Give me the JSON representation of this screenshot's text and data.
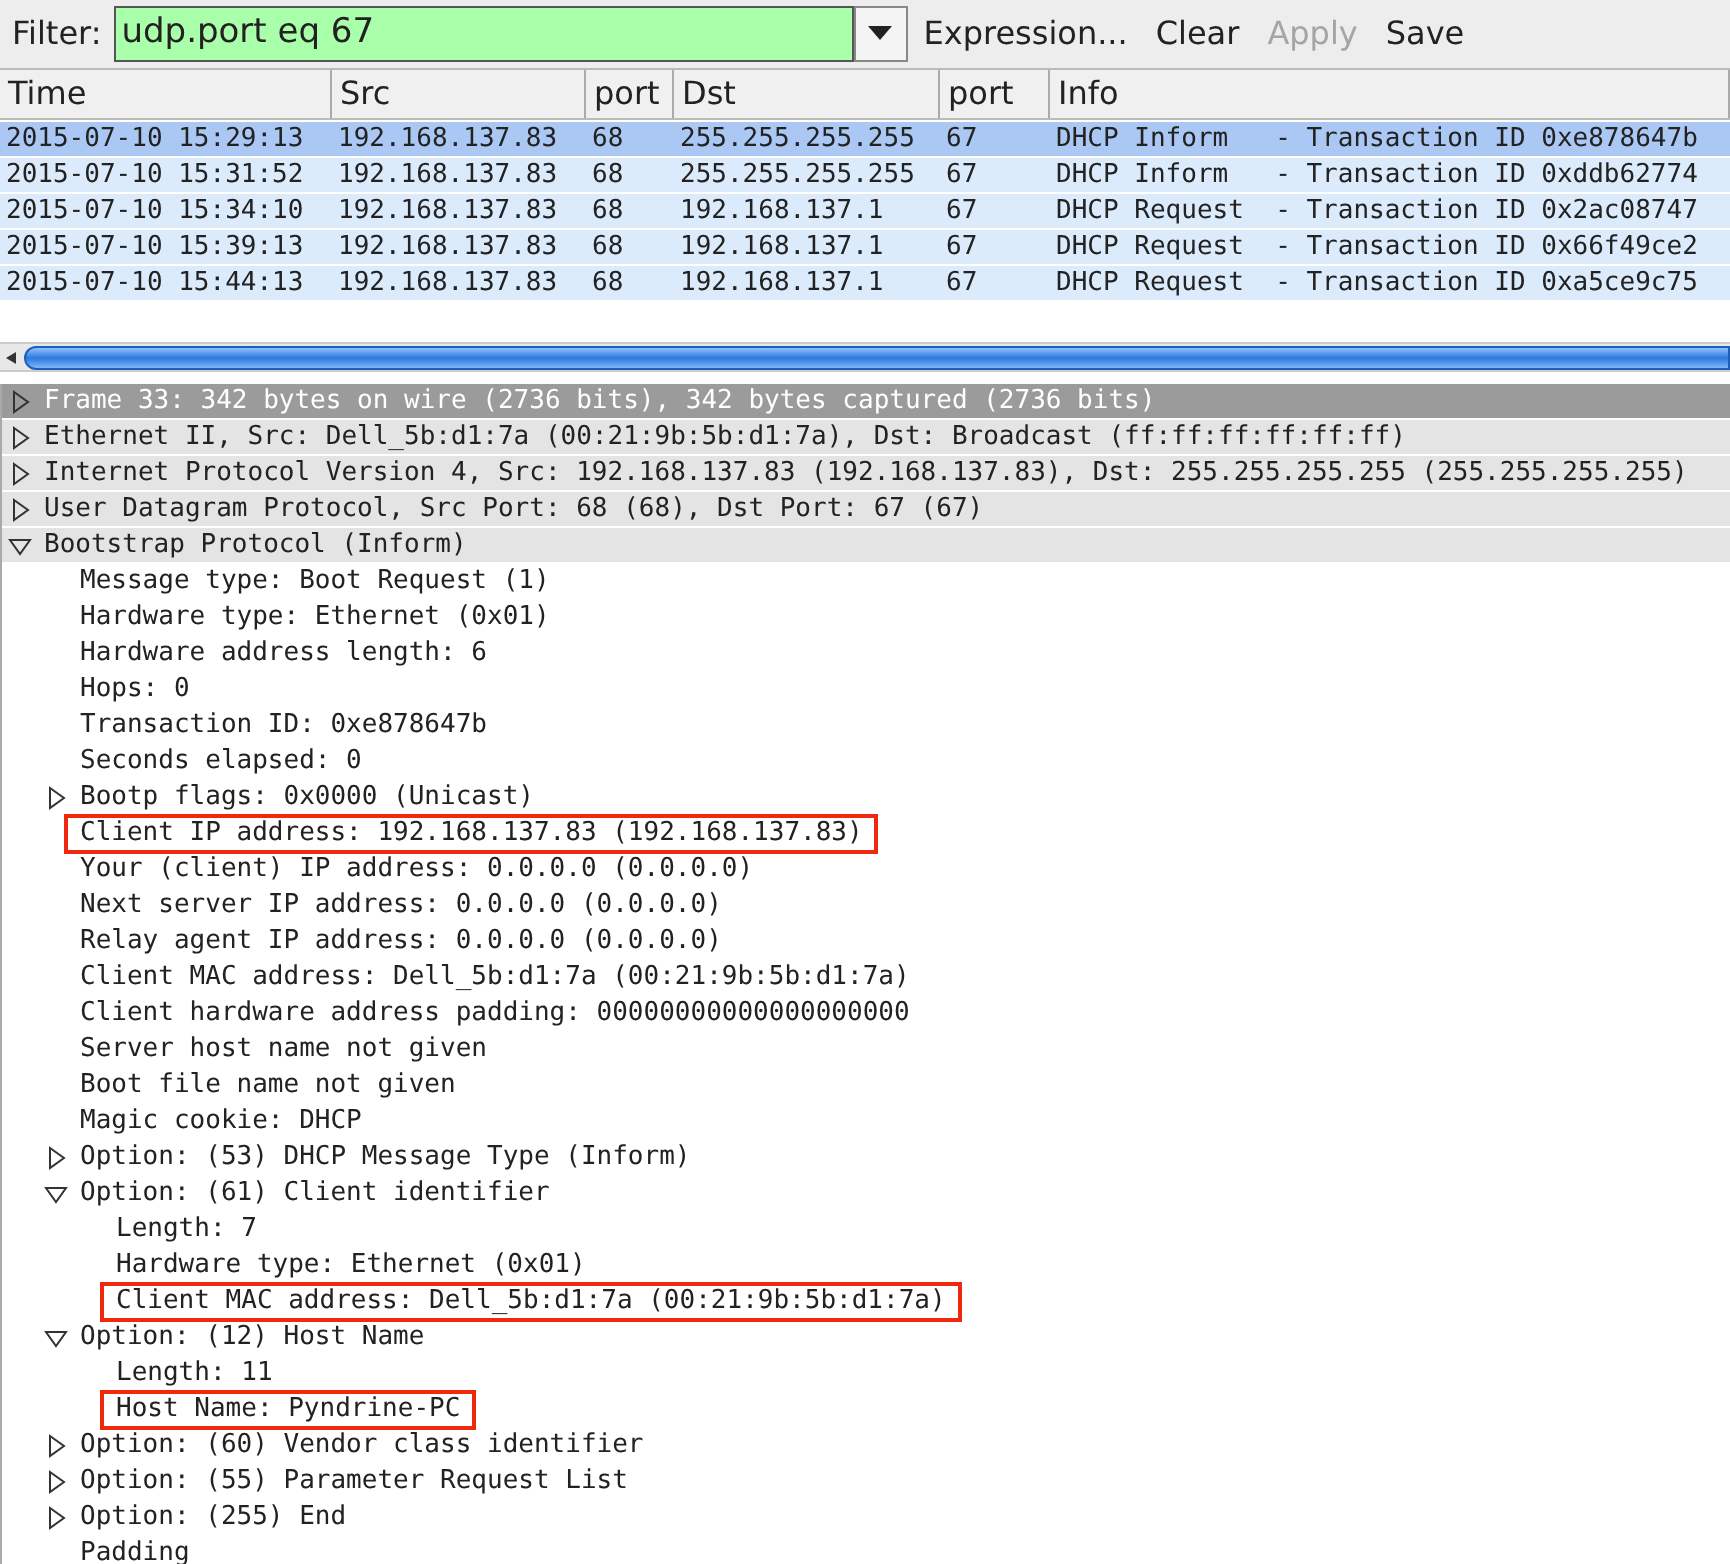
{
  "filter": {
    "label": "Filter:",
    "value": "udp.port eq 67",
    "buttons": [
      {
        "label": "Expression...",
        "disabled": false
      },
      {
        "label": "Clear",
        "disabled": false
      },
      {
        "label": "Apply",
        "disabled": true
      },
      {
        "label": "Save",
        "disabled": false
      }
    ]
  },
  "packet_list": {
    "columns": [
      "Time",
      "Src",
      "port",
      "Dst",
      "port",
      "Info"
    ],
    "rows": [
      {
        "selected": true,
        "cells": [
          "2015-07-10 15:29:13",
          "192.168.137.83",
          "68",
          "255.255.255.255",
          "67",
          "DHCP Inform   - Transaction ID 0xe878647b"
        ]
      },
      {
        "selected": false,
        "cells": [
          "2015-07-10 15:31:52",
          "192.168.137.83",
          "68",
          "255.255.255.255",
          "67",
          "DHCP Inform   - Transaction ID 0xddb62774"
        ]
      },
      {
        "selected": false,
        "cells": [
          "2015-07-10 15:34:10",
          "192.168.137.83",
          "68",
          "192.168.137.1",
          "67",
          "DHCP Request  - Transaction ID 0x2ac08747"
        ]
      },
      {
        "selected": false,
        "cells": [
          "2015-07-10 15:39:13",
          "192.168.137.83",
          "68",
          "192.168.137.1",
          "67",
          "DHCP Request  - Transaction ID 0x66f49ce2"
        ]
      },
      {
        "selected": false,
        "cells": [
          "2015-07-10 15:44:13",
          "192.168.137.83",
          "68",
          "192.168.137.1",
          "67",
          "DHCP Request  - Transaction ID 0xa5ce9c75"
        ]
      }
    ]
  },
  "details": [
    {
      "text": "Frame 33: 342 bytes on wire (2736 bits), 342 bytes captured (2736 bits)",
      "expanded": false,
      "selected": true,
      "highlighted": false
    },
    {
      "text": "Ethernet II, Src: Dell_5b:d1:7a (00:21:9b:5b:d1:7a), Dst: Broadcast (ff:ff:ff:ff:ff:ff)",
      "expanded": false,
      "selected": false,
      "highlighted": false
    },
    {
      "text": "Internet Protocol Version 4, Src: 192.168.137.83 (192.168.137.83), Dst: 255.255.255.255 (255.255.255.255)",
      "expanded": false,
      "selected": false,
      "highlighted": false
    },
    {
      "text": "User Datagram Protocol, Src Port: 68 (68), Dst Port: 67 (67)",
      "expanded": false,
      "selected": false,
      "highlighted": false
    },
    {
      "text": "Bootstrap Protocol (Inform)",
      "expanded": true,
      "selected": false,
      "highlighted": false,
      "children": [
        {
          "text": "Message type: Boot Request (1)",
          "selected": false,
          "highlighted": false
        },
        {
          "text": "Hardware type: Ethernet (0x01)",
          "selected": false,
          "highlighted": false
        },
        {
          "text": "Hardware address length: 6",
          "selected": false,
          "highlighted": false
        },
        {
          "text": "Hops: 0",
          "selected": false,
          "highlighted": false
        },
        {
          "text": "Transaction ID: 0xe878647b",
          "selected": false,
          "highlighted": false
        },
        {
          "text": "Seconds elapsed: 0",
          "selected": false,
          "highlighted": false
        },
        {
          "text": "Bootp flags: 0x0000 (Unicast)",
          "expanded": false,
          "selected": false,
          "highlighted": false
        },
        {
          "text": "Client IP address: 192.168.137.83 (192.168.137.83)",
          "selected": false,
          "highlighted": true
        },
        {
          "text": "Your (client) IP address: 0.0.0.0 (0.0.0.0)",
          "selected": false,
          "highlighted": false
        },
        {
          "text": "Next server IP address: 0.0.0.0 (0.0.0.0)",
          "selected": false,
          "highlighted": false
        },
        {
          "text": "Relay agent IP address: 0.0.0.0 (0.0.0.0)",
          "selected": false,
          "highlighted": false
        },
        {
          "text": "Client MAC address: Dell_5b:d1:7a (00:21:9b:5b:d1:7a)",
          "selected": false,
          "highlighted": false
        },
        {
          "text": "Client hardware address padding: 00000000000000000000",
          "selected": false,
          "highlighted": false
        },
        {
          "text": "Server host name not given",
          "selected": false,
          "highlighted": false
        },
        {
          "text": "Boot file name not given",
          "selected": false,
          "highlighted": false
        },
        {
          "text": "Magic cookie: DHCP",
          "selected": false,
          "highlighted": false
        },
        {
          "text": "Option: (53) DHCP Message Type (Inform)",
          "expanded": false,
          "selected": false,
          "highlighted": false
        },
        {
          "text": "Option: (61) Client identifier",
          "expanded": true,
          "selected": false,
          "highlighted": false,
          "children": [
            {
              "text": "Length: 7",
              "selected": false,
              "highlighted": false
            },
            {
              "text": "Hardware type: Ethernet (0x01)",
              "selected": false,
              "highlighted": false
            },
            {
              "text": "Client MAC address: Dell_5b:d1:7a (00:21:9b:5b:d1:7a)",
              "selected": false,
              "highlighted": true
            }
          ]
        },
        {
          "text": "Option: (12) Host Name",
          "expanded": true,
          "selected": false,
          "highlighted": false,
          "children": [
            {
              "text": "Length: 11",
              "selected": false,
              "highlighted": false
            },
            {
              "text": "Host Name: Pyndrine-PC",
              "selected": false,
              "highlighted": true
            }
          ]
        },
        {
          "text": "Option: (60) Vendor class identifier",
          "expanded": false,
          "selected": false,
          "highlighted": false
        },
        {
          "text": "Option: (55) Parameter Request List",
          "expanded": false,
          "selected": false,
          "highlighted": false
        },
        {
          "text": "Option: (255) End",
          "expanded": false,
          "selected": false,
          "highlighted": false
        },
        {
          "text": "Padding",
          "selected": false,
          "highlighted": false
        }
      ]
    }
  ]
}
